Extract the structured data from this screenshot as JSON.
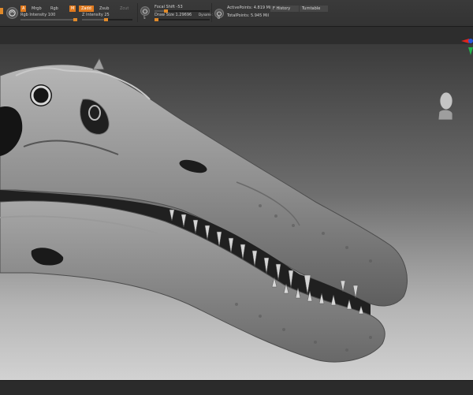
{
  "toolbar": {
    "color_group": {
      "buttons": {
        "a": "A",
        "mrgb": "Mrgb",
        "rgb": "Rgb",
        "m": "M"
      },
      "rgb_intensity": {
        "label": "Rgb Intensity",
        "value": "100"
      }
    },
    "sculpt_group": {
      "buttons": {
        "zadd": "Zadd",
        "zsub": "Zsub",
        "zcut": "Zcut"
      },
      "z_intensity": {
        "label": "Z Intensity",
        "value": "25"
      }
    },
    "focal": {
      "icon_label": "S",
      "label": "Focal Shift",
      "value": "-53",
      "level": 0.2
    },
    "draw": {
      "icon_label": "D",
      "label": "Draw Size",
      "value": "1.29696",
      "dynamic_label": "Dynamic",
      "level": 0.02
    },
    "stats": {
      "active_points": {
        "label": "ActivePoints:",
        "value": "4.819 Mil"
      },
      "total_points": {
        "label": "TotalPoints:",
        "value": "5.945 Mil"
      }
    },
    "history_label": "F History",
    "turntable_label": "Turntable"
  },
  "viewport": {
    "subject": "sculpted dinosaur skull",
    "gizmo_colors": {
      "x": "#e0241c",
      "y": "#22b24a",
      "z": "#2857d8"
    }
  }
}
